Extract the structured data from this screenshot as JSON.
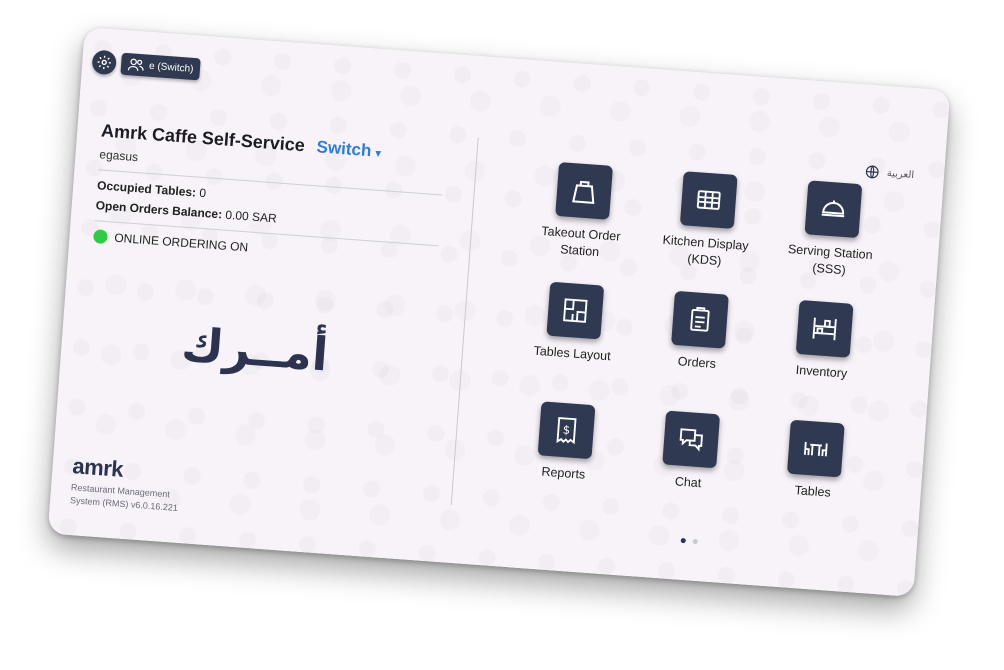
{
  "topbar": {
    "switch_user_label": "e (Switch)"
  },
  "store": {
    "name": "Amrk Caffe Self-Service",
    "switch_label": "Switch",
    "username": "egasus"
  },
  "stats": {
    "occupied_label": "Occupied Tables:",
    "occupied_value": "0",
    "balance_label": "Open Orders Balance:",
    "balance_value": "0.00 SAR"
  },
  "online_ordering": {
    "label": "ONLINE ORDERING ON",
    "status_color": "#2ecc40"
  },
  "logo_arabic": "أمــرك",
  "brand": {
    "name": "amrk",
    "subtitle": "Restaurant Management System (RMS) v6.0.16.221"
  },
  "language": {
    "label": "العربية",
    "icon": "globe-icon"
  },
  "tiles": [
    {
      "label": "Takeout Order Station",
      "icon": "takeout-bag-icon"
    },
    {
      "label": "Kitchen Display (KDS)",
      "icon": "grid-display-icon"
    },
    {
      "label": "Serving Station (SSS)",
      "icon": "serving-cloche-icon"
    },
    {
      "label": "Tables Layout",
      "icon": "floor-plan-icon"
    },
    {
      "label": "Orders",
      "icon": "clipboard-list-icon"
    },
    {
      "label": "Inventory",
      "icon": "shelves-icon"
    },
    {
      "label": "Reports",
      "icon": "receipt-dollar-icon"
    },
    {
      "label": "Chat",
      "icon": "chat-bubbles-icon"
    },
    {
      "label": "Tables",
      "icon": "table-chairs-icon"
    }
  ],
  "pager": {
    "current_page": 1,
    "total_pages": 2
  },
  "colors": {
    "accent": "#2c7be5",
    "tile_bg": "#2f3a52",
    "background": "#f7f3f9"
  }
}
